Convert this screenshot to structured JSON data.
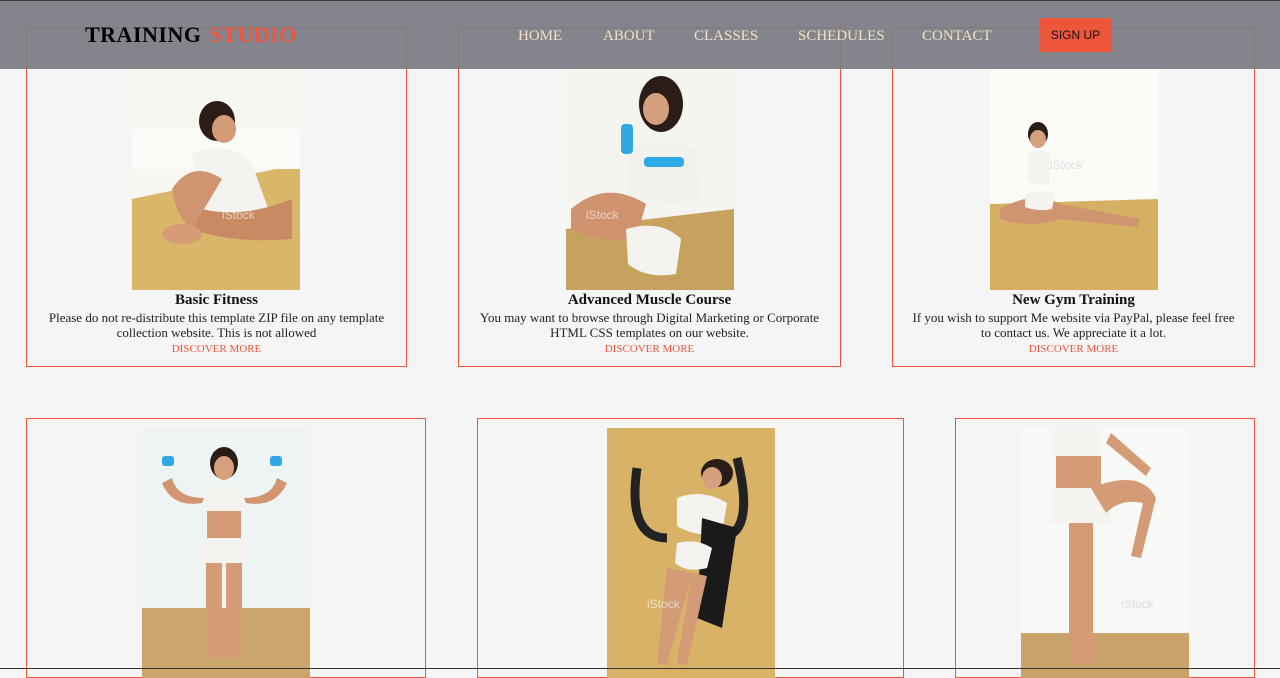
{
  "brand": {
    "main": "TRAINING",
    "accent": "STUDIO"
  },
  "nav": {
    "items": [
      {
        "label": "HOME"
      },
      {
        "label": "ABOUT"
      },
      {
        "label": "CLASSES"
      },
      {
        "label": "SCHEDULES"
      },
      {
        "label": "CONTACT"
      }
    ],
    "signup_label": "SIGN UP"
  },
  "cards": [
    {
      "title": "Basic Fitness",
      "description": "Please do not re-distribute this template ZIP file on any template collection website. This is not allowed",
      "link": "DISCOVER MORE"
    },
    {
      "title": "Advanced Muscle Course",
      "description": "You may want to browse through Digital Marketing or Corporate HTML CSS templates on our website.",
      "link": "DISCOVER MORE"
    },
    {
      "title": "New Gym Training",
      "description": "If you wish to support Me website via PayPal, please feel free to contact us. We appreciate it a lot.",
      "link": "DISCOVER MORE"
    },
    {
      "title": "",
      "description": "",
      "link": ""
    },
    {
      "title": "",
      "description": "",
      "link": ""
    },
    {
      "title": "",
      "description": "",
      "link": ""
    }
  ],
  "colors": {
    "accent": "#ed563b",
    "background": "#f5f5f5",
    "navbar": "#797982",
    "nav_text": "#f3e2c5"
  },
  "watermark": "iStock"
}
